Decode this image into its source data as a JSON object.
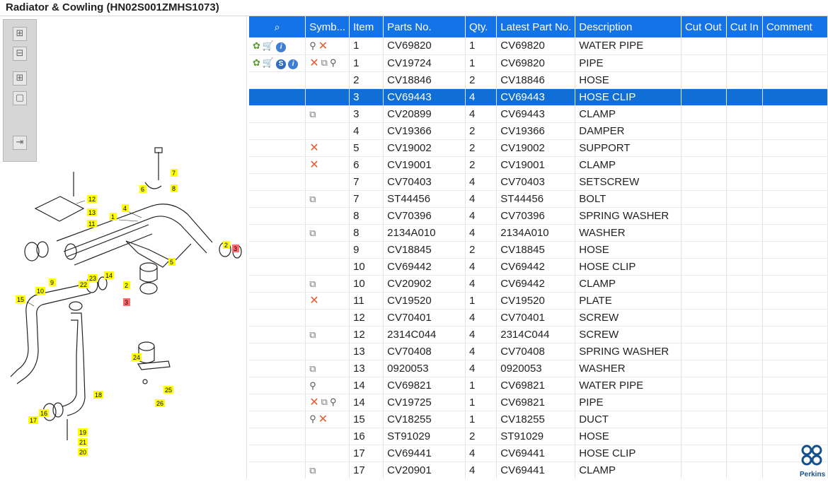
{
  "title": "Radiator & Cowling (HN02S001ZMHS1073)",
  "toolbox": {
    "buttons": [
      {
        "icon": "zoom-in-icon",
        "glyph": "⊞"
      },
      {
        "icon": "zoom-out-icon",
        "glyph": "⊟"
      },
      {
        "icon": "fit-all-icon",
        "glyph": "⊞"
      },
      {
        "icon": "fit-page-icon",
        "glyph": "▢"
      },
      {
        "icon": "export-icon",
        "glyph": "⇥"
      }
    ]
  },
  "diagram": {
    "callouts": [
      "1",
      "2",
      "3",
      "4",
      "5",
      "6",
      "7",
      "8",
      "9",
      "10",
      "11",
      "12",
      "13",
      "14",
      "15",
      "16",
      "17",
      "18",
      "19",
      "20",
      "21",
      "22",
      "23",
      "24",
      "25",
      "26",
      "2",
      "3"
    ]
  },
  "table": {
    "headers": [
      "Symb...",
      "Item",
      "Parts No.",
      "Qty.",
      "Latest Part No.",
      "Description",
      "Cut Out",
      "Cut In",
      "Comment"
    ],
    "rows": [
      {
        "act": [
          "gear",
          "cart",
          "info"
        ],
        "sym": [
          "pin",
          "x"
        ],
        "item": "1",
        "part": "CV69820",
        "qty": "1",
        "latest": "CV69820",
        "desc": "WATER PIPE"
      },
      {
        "act": [
          "gear",
          "cart",
          "s",
          "info"
        ],
        "sym": [
          "x",
          "book",
          "pin"
        ],
        "item": "1",
        "part": "CV19724",
        "qty": "1",
        "latest": "CV69820",
        "desc": "PIPE"
      },
      {
        "act": [],
        "sym": [],
        "item": "2",
        "part": "CV18846",
        "qty": "2",
        "latest": "CV18846",
        "desc": "HOSE"
      },
      {
        "act": [],
        "sym": [],
        "item": "3",
        "part": "CV69443",
        "qty": "4",
        "latest": "CV69443",
        "desc": "HOSE CLIP",
        "selected": true
      },
      {
        "act": [],
        "sym": [
          "book"
        ],
        "item": "3",
        "part": "CV20899",
        "qty": "4",
        "latest": "CV69443",
        "desc": "CLAMP"
      },
      {
        "act": [],
        "sym": [],
        "item": "4",
        "part": "CV19366",
        "qty": "2",
        "latest": "CV19366",
        "desc": "DAMPER"
      },
      {
        "act": [],
        "sym": [
          "x"
        ],
        "item": "5",
        "part": "CV19002",
        "qty": "2",
        "latest": "CV19002",
        "desc": "SUPPORT"
      },
      {
        "act": [],
        "sym": [
          "x"
        ],
        "item": "6",
        "part": "CV19001",
        "qty": "2",
        "latest": "CV19001",
        "desc": "CLAMP"
      },
      {
        "act": [],
        "sym": [],
        "item": "7",
        "part": "CV70403",
        "qty": "4",
        "latest": "CV70403",
        "desc": "SETSCREW"
      },
      {
        "act": [],
        "sym": [
          "book"
        ],
        "item": "7",
        "part": "ST44456",
        "qty": "4",
        "latest": "ST44456",
        "desc": "BOLT"
      },
      {
        "act": [],
        "sym": [],
        "item": "8",
        "part": "CV70396",
        "qty": "4",
        "latest": "CV70396",
        "desc": "SPRING WASHER"
      },
      {
        "act": [],
        "sym": [
          "book"
        ],
        "item": "8",
        "part": "2134A010",
        "qty": "4",
        "latest": "2134A010",
        "desc": "WASHER"
      },
      {
        "act": [],
        "sym": [],
        "item": "9",
        "part": "CV18845",
        "qty": "2",
        "latest": "CV18845",
        "desc": "HOSE"
      },
      {
        "act": [],
        "sym": [],
        "item": "10",
        "part": "CV69442",
        "qty": "4",
        "latest": "CV69442",
        "desc": "HOSE CLIP"
      },
      {
        "act": [],
        "sym": [
          "book"
        ],
        "item": "10",
        "part": "CV20902",
        "qty": "4",
        "latest": "CV69442",
        "desc": "CLAMP"
      },
      {
        "act": [],
        "sym": [
          "x"
        ],
        "item": "11",
        "part": "CV19520",
        "qty": "1",
        "latest": "CV19520",
        "desc": "PLATE"
      },
      {
        "act": [],
        "sym": [],
        "item": "12",
        "part": "CV70401",
        "qty": "4",
        "latest": "CV70401",
        "desc": "SCREW"
      },
      {
        "act": [],
        "sym": [
          "book"
        ],
        "item": "12",
        "part": "2314C044",
        "qty": "4",
        "latest": "2314C044",
        "desc": "SCREW"
      },
      {
        "act": [],
        "sym": [],
        "item": "13",
        "part": "CV70408",
        "qty": "4",
        "latest": "CV70408",
        "desc": "SPRING WASHER"
      },
      {
        "act": [],
        "sym": [
          "book"
        ],
        "item": "13",
        "part": "0920053",
        "qty": "4",
        "latest": "0920053",
        "desc": "WASHER"
      },
      {
        "act": [],
        "sym": [
          "pin"
        ],
        "item": "14",
        "part": "CV69821",
        "qty": "1",
        "latest": "CV69821",
        "desc": "WATER PIPE"
      },
      {
        "act": [],
        "sym": [
          "x",
          "book",
          "pin"
        ],
        "item": "14",
        "part": "CV19725",
        "qty": "1",
        "latest": "CV69821",
        "desc": "PIPE"
      },
      {
        "act": [],
        "sym": [
          "pin",
          "x"
        ],
        "item": "15",
        "part": "CV18255",
        "qty": "1",
        "latest": "CV18255",
        "desc": "DUCT"
      },
      {
        "act": [],
        "sym": [],
        "item": "16",
        "part": "ST91029",
        "qty": "2",
        "latest": "ST91029",
        "desc": "HOSE"
      },
      {
        "act": [],
        "sym": [],
        "item": "17",
        "part": "CV69441",
        "qty": "4",
        "latest": "CV69441",
        "desc": "HOSE CLIP"
      },
      {
        "act": [],
        "sym": [
          "book"
        ],
        "item": "17",
        "part": "CV20901",
        "qty": "4",
        "latest": "CV69441",
        "desc": "CLAMP"
      }
    ]
  },
  "logo": {
    "text": "Perkins"
  }
}
